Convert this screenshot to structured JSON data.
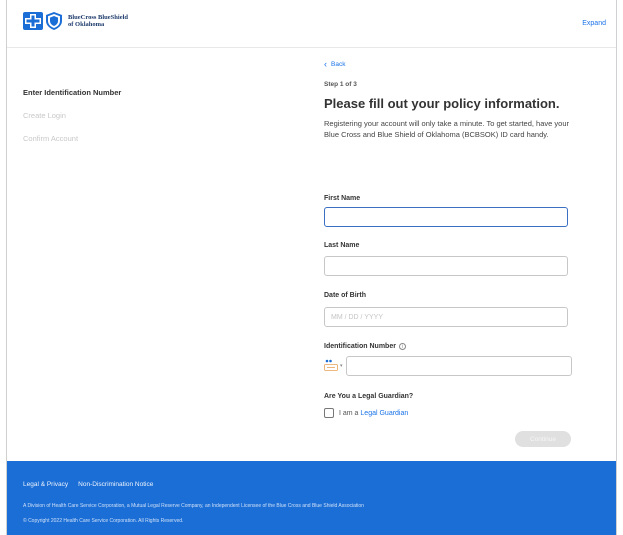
{
  "header": {
    "brand_line1": "BlueCross BlueShield",
    "brand_line2": "of Oklahoma",
    "expand_label": "Expand",
    "brand_colors": {
      "navy": "#1d3a6b",
      "blue": "#1b6ed6",
      "light_blue": "#5aa0e6"
    }
  },
  "steps": [
    {
      "label": "Enter Identification Number",
      "state": "active"
    },
    {
      "label": "Create Login",
      "state": "inactive"
    },
    {
      "label": "Confirm Account",
      "state": "inactive"
    }
  ],
  "form": {
    "back_label": "Back",
    "step_indicator": "Step 1 of 3",
    "title": "Please fill out your policy information.",
    "intro": "Registering your account will only take a minute. To get started, have your Blue Cross and Blue Shield of Oklahoma (BCBSOK) ID card handy.",
    "first_name": {
      "label": "First Name",
      "value": ""
    },
    "last_name": {
      "label": "Last Name",
      "value": ""
    },
    "dob": {
      "label": "Date of Birth",
      "placeholder": "MM / DD / YYYY",
      "value": ""
    },
    "id_number": {
      "label": "Identification Number",
      "value": ""
    },
    "guardian": {
      "label": "Are You a Legal Guardian?",
      "checkbox_prefix": "I am a ",
      "checkbox_link": "Legal Guardian",
      "checked": false
    },
    "continue_label": "Continue"
  },
  "footer": {
    "links": [
      "Legal & Privacy",
      "Non-Discrimination Notice"
    ],
    "division": "A Division of Health Care Service Corporation, a Mutual Legal Reserve Company, an Independent Licensee of the Blue Cross and Blue Shield Association",
    "copyright": "© Copyright 2022 Health Care Service Corporation. All Rights Reserved."
  },
  "icons": [
    "bluecross-logo-icon",
    "blueshield-logo-icon",
    "chevron-left-icon",
    "info-icon",
    "id-card-icon",
    "chevron-down-icon",
    "checkbox-icon"
  ],
  "accent_color": "#1a73e8"
}
